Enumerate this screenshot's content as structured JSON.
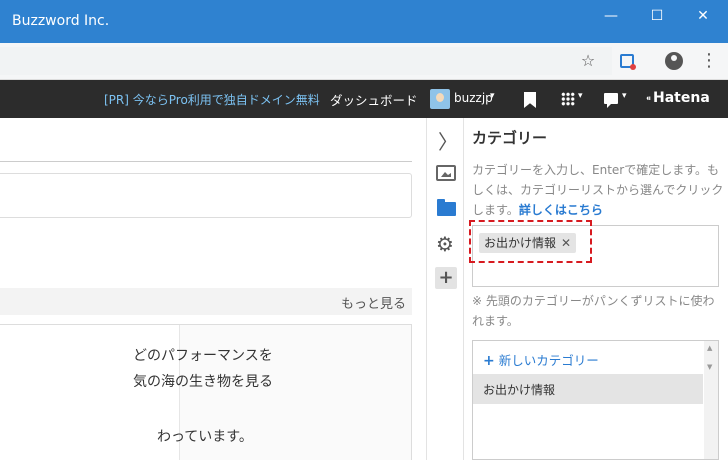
{
  "window": {
    "title": "Buzzword Inc.",
    "min_glyph": "—",
    "max_glyph": "☐",
    "close_glyph": "✕"
  },
  "browser": {
    "star_glyph": "☆",
    "kebab_glyph": "⋮",
    "icons": [
      "star-icon",
      "extension-icon",
      "profile-icon",
      "kebab-menu-icon"
    ]
  },
  "hatena_header": {
    "promo": "[PR] 今ならPro利用で独自ドメイン無料",
    "dashboard": "ダッシュボード",
    "username": "buzzjp",
    "caret": "▾",
    "logo": "Hatena",
    "logo_mark": "⁌"
  },
  "editor": {
    "more_link": "もっと見る",
    "body_lines": [
      "どのパフォーマンスを",
      "気の海の生き物を見る",
      "わっています。"
    ]
  },
  "sidebar": {
    "collapse_glyph": "〉",
    "gear_glyph": "⚙",
    "plus_glyph": "+"
  },
  "category_panel": {
    "title": "カテゴリー",
    "description": "カテゴリーを入力し、Enterで確定します。もしくは、カテゴリーリストから選んでクリックします。",
    "details_link": "詳しくはこちら",
    "selected_tag": "お出かけ情報",
    "remove_glyph": "✕",
    "note": "※ 先頭のカテゴリーがパンくずリストに使われます。",
    "new_category": "新しいカテゴリー",
    "new_category_plus": "+",
    "list_items": [
      "お出かけ情報"
    ],
    "scroll_up": "▲",
    "scroll_down": "▼"
  },
  "colors": {
    "titlebar": "#2f82d0",
    "header": "#2c2c2c",
    "promo": "#7cc2f2",
    "accent": "#2a7bd1",
    "highlight_dashed": "#d71a20"
  }
}
